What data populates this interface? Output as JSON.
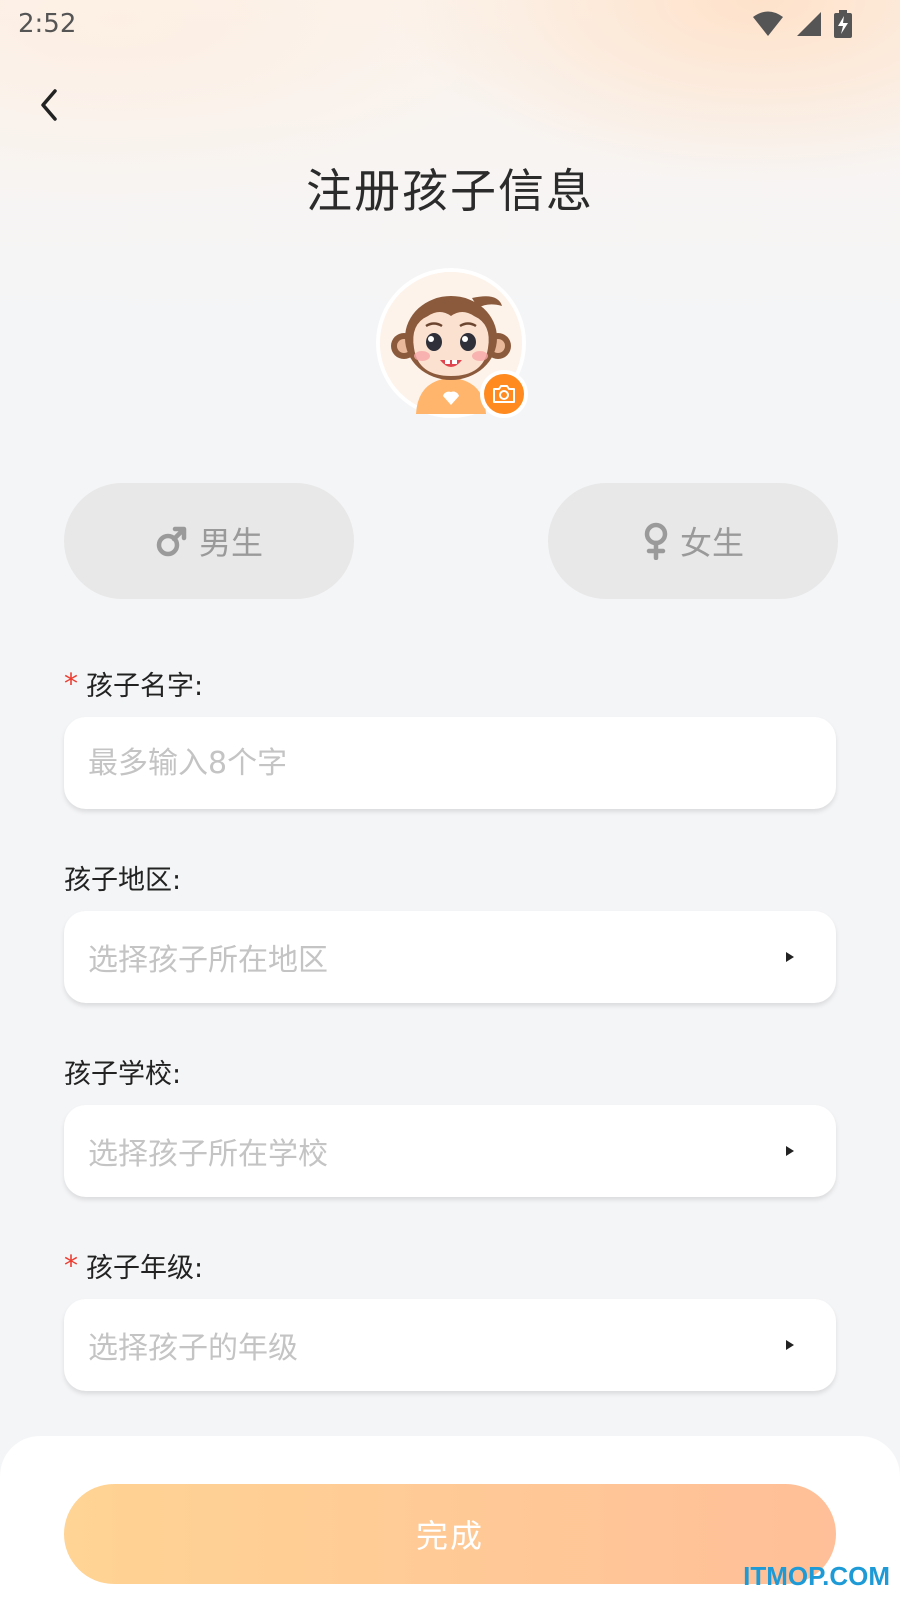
{
  "status_bar": {
    "time": "2:52"
  },
  "header": {
    "title": "注册孩子信息"
  },
  "gender": {
    "male_label": "男生",
    "female_label": "女生"
  },
  "fields": {
    "name": {
      "label": "孩子名字:",
      "placeholder": "最多输入8个字",
      "required": true
    },
    "region": {
      "label": "孩子地区:",
      "placeholder": "选择孩子所在地区",
      "required": false
    },
    "school": {
      "label": "孩子学校:",
      "placeholder": "选择孩子所在学校",
      "required": false
    },
    "grade": {
      "label": "孩子年级:",
      "placeholder": "选择孩子的年级",
      "required": true
    }
  },
  "required_mark": "*",
  "footer": {
    "submit_label": "完成"
  },
  "watermark": "ITMOP.COM",
  "colors": {
    "accent_orange": "#ff8a1f",
    "required_red": "#ee3b2f",
    "button_from": "#ffd494",
    "button_to": "#ffbf98"
  }
}
